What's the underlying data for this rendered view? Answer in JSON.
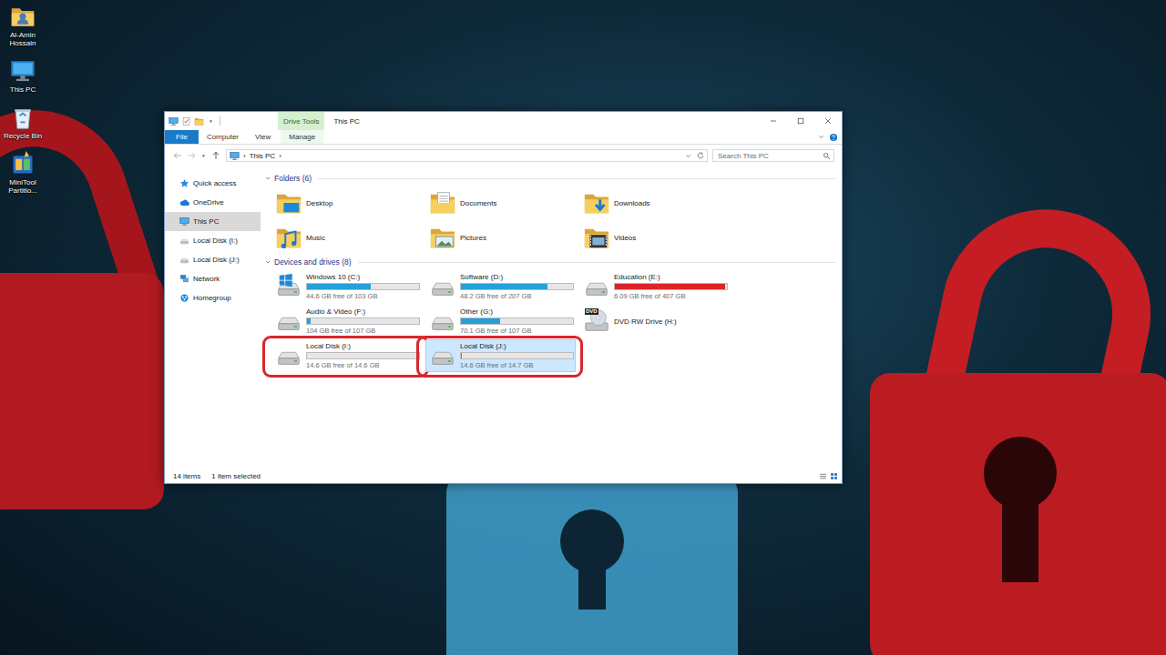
{
  "desktop": {
    "icons": [
      {
        "label": "Al-Amin Hossain",
        "kind": "user"
      },
      {
        "label": "This PC",
        "kind": "pc"
      },
      {
        "label": "Recycle Bin",
        "kind": "recycle"
      },
      {
        "label": "MiniTool Partitio...",
        "kind": "minitool"
      }
    ]
  },
  "window": {
    "title": "This PC",
    "context_label": "Drive Tools"
  },
  "ribbon": {
    "tabs": [
      {
        "label": "File",
        "kind": "file"
      },
      {
        "label": "Computer",
        "kind": "normal"
      },
      {
        "label": "View",
        "kind": "normal"
      },
      {
        "label": "Manage",
        "kind": "context"
      }
    ]
  },
  "address": {
    "separator": "›",
    "crumbs": [
      "This PC"
    ]
  },
  "search": {
    "placeholder": "Search This PC"
  },
  "nav": {
    "items": [
      {
        "label": "Quick access",
        "kind": "quick",
        "selected": false
      },
      {
        "label": "OneDrive",
        "kind": "onedrive",
        "selected": false
      },
      {
        "label": "This PC",
        "kind": "pc",
        "selected": true
      },
      {
        "label": "Local Disk (I:)",
        "kind": "disk",
        "selected": false
      },
      {
        "label": "Local Disk (J:)",
        "kind": "disk",
        "selected": false
      },
      {
        "label": "Network",
        "kind": "network",
        "selected": false
      },
      {
        "label": "Homegroup",
        "kind": "homegroup",
        "selected": false
      }
    ]
  },
  "groups": [
    {
      "header": "Folders (6)",
      "expanded": true,
      "items": [
        {
          "name": "Desktop",
          "kind": "desktop",
          "selected": false
        },
        {
          "name": "Documents",
          "kind": "documents",
          "selected": false
        },
        {
          "name": "Downloads",
          "kind": "downloads",
          "selected": false
        },
        {
          "name": "Music",
          "kind": "music",
          "selected": false
        },
        {
          "name": "Pictures",
          "kind": "pictures",
          "selected": false
        },
        {
          "name": "Videos",
          "kind": "videos",
          "selected": false
        }
      ]
    },
    {
      "header": "Devices and drives (8)",
      "expanded": true,
      "items": [
        {
          "name": "Windows 10 (C:)",
          "kind": "windows",
          "selected": false,
          "annotated": false,
          "level": 0.57,
          "color": "#26a0da",
          "free": "44.6 GB free of 103 GB"
        },
        {
          "name": "Software (D:)",
          "kind": "drive",
          "selected": false,
          "annotated": false,
          "level": 0.77,
          "color": "#26a0da",
          "free": "48.2 GB free of 207 GB"
        },
        {
          "name": "Education (E:)",
          "kind": "drive",
          "selected": false,
          "annotated": false,
          "level": 0.985,
          "color": "#da2626",
          "free": "6.09 GB free of 407 GB"
        },
        {
          "name": "Audio & Video (F:)",
          "kind": "drive",
          "selected": false,
          "annotated": false,
          "level": 0.03,
          "color": "#26a0da",
          "free": "104 GB free of 107 GB"
        },
        {
          "name": "Other (G:)",
          "kind": "drive",
          "selected": false,
          "annotated": false,
          "level": 0.35,
          "color": "#26a0da",
          "free": "70.1 GB free of 107 GB"
        },
        {
          "name": "DVD RW Drive (H:)",
          "kind": "dvd",
          "selected": false,
          "annotated": false,
          "icon_label": "DVD"
        },
        {
          "name": "Local Disk (I:)",
          "kind": "drive",
          "selected": false,
          "annotated": true,
          "level": 0.0,
          "color": "#26a0da",
          "free": "14.6 GB free of 14.6 GB"
        },
        {
          "name": "Local Disk (J:)",
          "kind": "drive",
          "selected": true,
          "annotated": true,
          "level": 0.005,
          "color": "#26a0da",
          "free": "14.6 GB free of 14.7 GB"
        }
      ]
    }
  ],
  "status_bar": {
    "count": "14 items",
    "selection": "1 item selected"
  }
}
